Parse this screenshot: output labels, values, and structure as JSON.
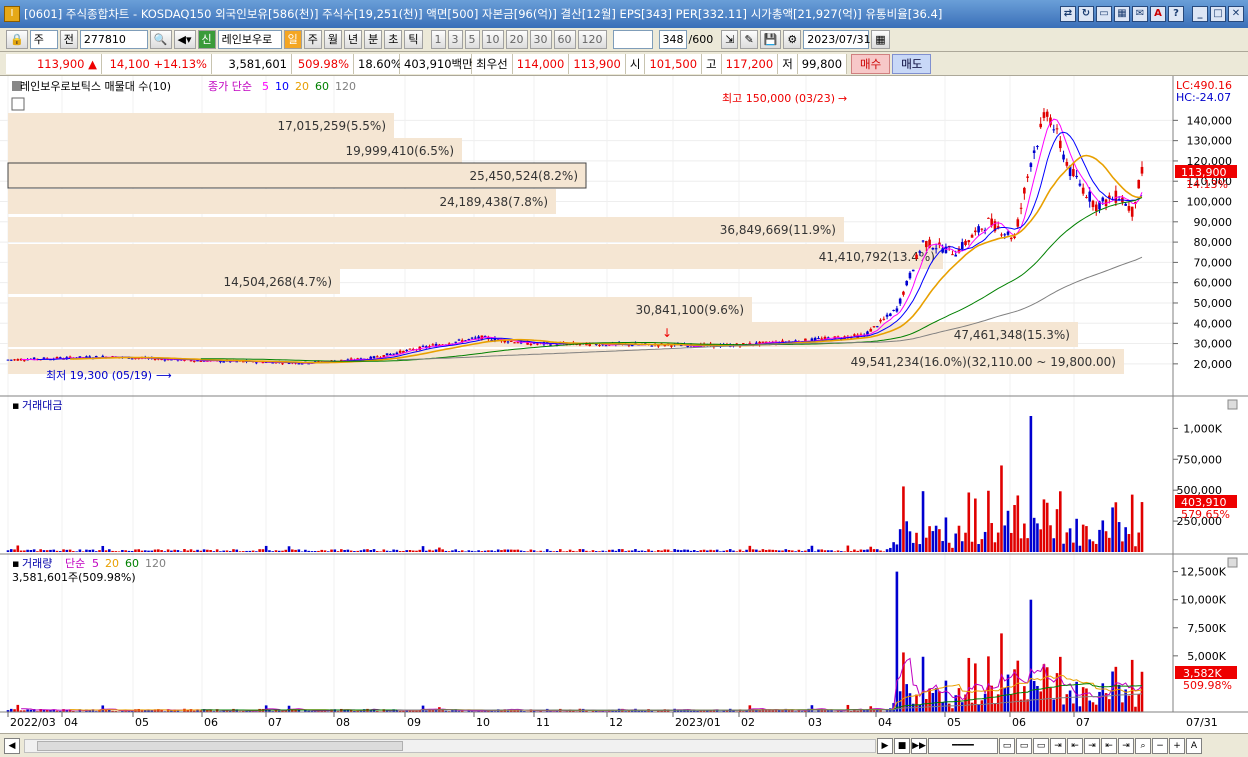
{
  "window": {
    "title": "[0601] 주식종합차트 - KOSDAQ150 외국인보유[586(천)] 주식수[19,251(천)] 액면[500] 자본금[96(억)] 결산[12월] EPS[343] PER[332.11] 시가총액[21,927(억)] 유통비율[36.4]",
    "app_icon": "I"
  },
  "toolbar": {
    "code": "277810",
    "name": "레인보우로",
    "period_label": "일",
    "periods": [
      "주",
      "월",
      "년",
      "분",
      "초",
      "틱"
    ],
    "ticks": [
      "1",
      "3",
      "5",
      "10",
      "20",
      "30",
      "60",
      "120"
    ],
    "count": "348",
    "count_total": "/600",
    "date": "2023/07/31",
    "mode": "주",
    "mode2": "전",
    "new_badge": "신"
  },
  "quote": {
    "price": "113,900",
    "change": "14,100",
    "change_pct": "+14.13%",
    "volume": "3,581,601",
    "vol_ratio": "509.98%",
    "turnover": "18.60%",
    "amount": "403,910백만",
    "best_label": "최우선",
    "ask": "114,000",
    "bid": "113,900",
    "open_label": "시",
    "open": "101,500",
    "high_label": "고",
    "high": "117,200",
    "low_label": "저",
    "low": "99,800",
    "buy": "매수",
    "sell": "매도"
  },
  "price_panel": {
    "legend_name": "레인보우로보틱스 매물대 수(10)",
    "ma_label": "종가 단순",
    "ma_periods": [
      "5",
      "10",
      "20",
      "60",
      "120"
    ],
    "ma_colors": [
      "#ff00ff",
      "#0000ff",
      "#e8a000",
      "#008000",
      "#808080"
    ],
    "lc": "LC:490.16",
    "hc": "HC:-24.07",
    "last_price": "113,900",
    "last_pct": "14.13%",
    "high_note": "최고 150,000 (03/23)",
    "low_note": "최저 19,300 (05/19)",
    "yticks": [
      "140,000",
      "130,000",
      "120,000",
      "110,000",
      "100,000",
      "90,000",
      "80,000",
      "70,000",
      "60,000",
      "50,000",
      "40,000",
      "30,000",
      "20,000"
    ],
    "volume_profile": [
      "17,015,259(5.5%)",
      "19,999,410(6.5%)",
      "25,450,524(8.2%)",
      "24,189,438(7.8%)",
      "36,849,669(11.9%)",
      "41,410,792(13.4%)",
      "14,504,268(4.7%)",
      "30,841,100(9.6%)",
      "47,461,348(15.3%)",
      "49,541,234(16.0%)(32,110.00 ~ 19,800.00)"
    ]
  },
  "amount_panel": {
    "title": "거래대금",
    "yticks": [
      "1,000K",
      "750,000",
      "500,000",
      "250,000"
    ],
    "last": "403,910",
    "last_pct": "579.65%"
  },
  "volume_panel": {
    "title": "거래량",
    "ma_label": "단순",
    "ma_periods": [
      "5",
      "20",
      "60",
      "120"
    ],
    "value": "3,581,601주(509.98%)",
    "yticks": [
      "12,500K",
      "10,000K",
      "7,500K",
      "5,000K"
    ],
    "last": "3,582K",
    "last_pct": "509.98%"
  },
  "x_axis": {
    "labels": [
      "2022/03",
      "04",
      "05",
      "06",
      "07",
      "08",
      "09",
      "10",
      "11",
      "12",
      "2023/01",
      "02",
      "03",
      "04",
      "05",
      "06",
      "07"
    ],
    "end": "07/31"
  },
  "colors": {
    "up": "#e00000",
    "down": "#0000d0",
    "profile": "#f5e6d3"
  },
  "chart_data": {
    "type": "candlestick",
    "price_range": [
      15000,
      152000
    ],
    "note": "daily candles 2022/03 ~ 2023/07/31"
  }
}
